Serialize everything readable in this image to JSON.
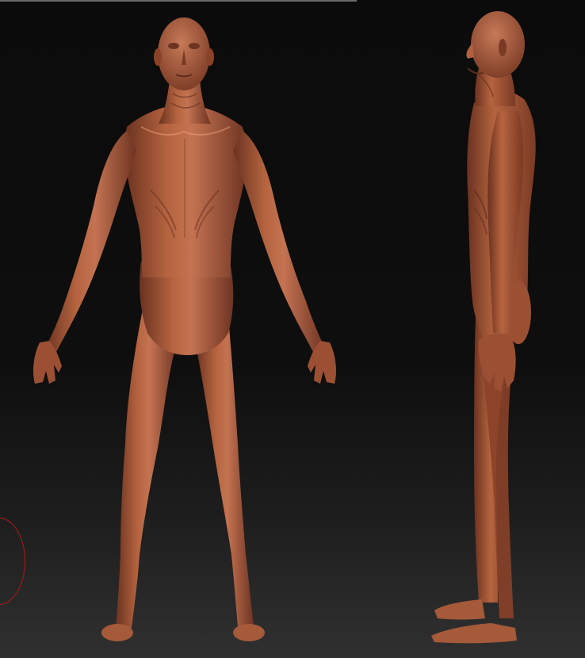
{
  "canvas": {
    "background_top": "#0b0b0b",
    "background_bottom": "#303030",
    "top_strip_color": "#6a6a6a"
  },
  "model": {
    "skin_base": "#a8583a",
    "skin_highlight": "#c87a58",
    "skin_shadow": "#5e2c1a",
    "views": [
      "front",
      "side"
    ]
  },
  "brush": {
    "ring_color": "#b01818"
  }
}
